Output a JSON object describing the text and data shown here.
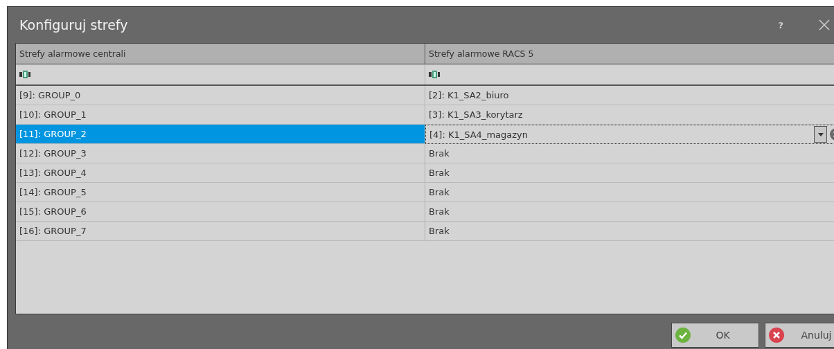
{
  "window": {
    "title": "Konfiguruj strefy",
    "help": "?"
  },
  "table": {
    "columns": [
      "Strefy alarmowe centrali",
      "Strefy alarmowe RACS 5"
    ],
    "rows": [
      {
        "cells": [
          "[9]: GROUP_0",
          "[2]: K1_SA2_biuro"
        ],
        "selected": false,
        "editing": false
      },
      {
        "cells": [
          "[10]: GROUP_1",
          "[3]: K1_SA3_korytarz"
        ],
        "selected": false,
        "editing": false
      },
      {
        "cells": [
          "[11]: GROUP_2",
          "[4]: K1_SA4_magazyn"
        ],
        "selected": true,
        "editing": true
      },
      {
        "cells": [
          "[12]: GROUP_3",
          "Brak"
        ],
        "selected": false,
        "editing": false
      },
      {
        "cells": [
          "[13]: GROUP_4",
          "Brak"
        ],
        "selected": false,
        "editing": false
      },
      {
        "cells": [
          "[14]: GROUP_5",
          "Brak"
        ],
        "selected": false,
        "editing": false
      },
      {
        "cells": [
          "[15]: GROUP_6",
          "Brak"
        ],
        "selected": false,
        "editing": false
      },
      {
        "cells": [
          "[16]: GROUP_7",
          "Brak"
        ],
        "selected": false,
        "editing": false
      }
    ]
  },
  "buttons": [
    {
      "label": "OK",
      "kind": "ok"
    },
    {
      "label": "Anuluj",
      "kind": "cancel"
    }
  ]
}
